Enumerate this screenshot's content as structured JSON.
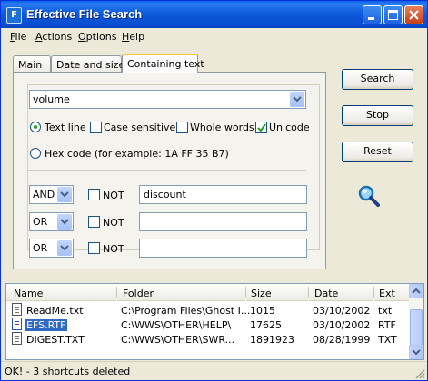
{
  "window": {
    "title": "Effective File Search",
    "icon_letter": "F"
  },
  "menu": [
    {
      "hot": "F",
      "rest": "ile"
    },
    {
      "hot": "A",
      "rest": "ctions"
    },
    {
      "hot": "O",
      "rest": "ptions"
    },
    {
      "hot": "H",
      "rest": "elp"
    }
  ],
  "tabs": [
    "Main",
    "Date and size",
    "Containing text"
  ],
  "active_tab": "Containing text",
  "text_combo": {
    "value": "volume"
  },
  "options": {
    "text_line": {
      "label": "Text line",
      "selected": true
    },
    "case_sensitive": {
      "label": "Case sensitive",
      "checked": false
    },
    "whole_words": {
      "label": "Whole words",
      "checked": false
    },
    "unicode": {
      "label": "Unicode",
      "checked": true
    },
    "hex_code": {
      "label": "Hex code (for example: 1A FF 35 B7)",
      "selected": false
    }
  },
  "conditions": [
    {
      "operator": "AND",
      "not_label": "NOT",
      "not_checked": false,
      "text": "discount"
    },
    {
      "operator": "OR",
      "not_label": "NOT",
      "not_checked": false,
      "text": ""
    },
    {
      "operator": "OR",
      "not_label": "NOT",
      "not_checked": false,
      "text": ""
    }
  ],
  "buttons": {
    "search": "Search",
    "stop": "Stop",
    "reset": "Reset"
  },
  "icons": {
    "search_icon": "magnifier-icon"
  },
  "results": {
    "columns": [
      "Name",
      "Folder",
      "Size",
      "Date",
      "Ext"
    ],
    "rows": [
      {
        "name": "ReadMe.txt",
        "folder": "C:\\Program Files\\Ghost I...",
        "size": "1015",
        "date": "03/10/2002",
        "ext": "txt",
        "selected": false
      },
      {
        "name": "EFS.RTF",
        "folder": "C:\\WWS\\OTHER\\HELP\\",
        "size": "17625",
        "date": "03/10/2002",
        "ext": "RTF",
        "selected": true
      },
      {
        "name": "DIGEST.TXT",
        "folder": "C:\\WWS\\OTHER\\SWR...",
        "size": "1891923",
        "date": "08/28/1999",
        "ext": "TXT",
        "selected": false
      }
    ]
  },
  "status": {
    "text": "OK! - 3 shortcuts deleted"
  },
  "colors": {
    "titlebar": "#0a4ed0",
    "selection": "#316ac5",
    "check_green": "#21a121",
    "tab_accent": "#ffc83c"
  }
}
